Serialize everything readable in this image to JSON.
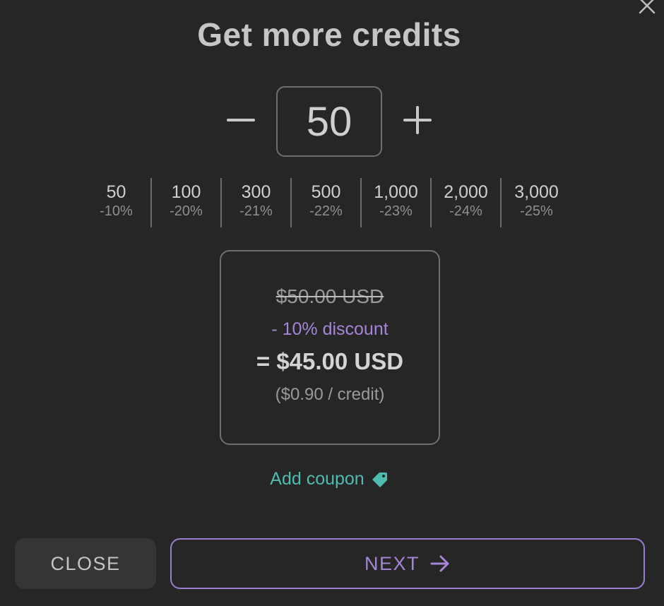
{
  "dialog": {
    "title": "Get more credits"
  },
  "stepper": {
    "quantity": "50"
  },
  "presets": [
    {
      "amount": "50",
      "discount": "-10%"
    },
    {
      "amount": "100",
      "discount": "-20%"
    },
    {
      "amount": "300",
      "discount": "-21%"
    },
    {
      "amount": "500",
      "discount": "-22%"
    },
    {
      "amount": "1,000",
      "discount": "-23%"
    },
    {
      "amount": "2,000",
      "discount": "-24%"
    },
    {
      "amount": "3,000",
      "discount": "-25%"
    }
  ],
  "price": {
    "original": "$50.00 USD",
    "discount": "- 10% discount",
    "total": "= $45.00 USD",
    "per_credit": "($0.90 / credit)"
  },
  "coupon": {
    "label": "Add coupon"
  },
  "buttons": {
    "close_label": "CLOSE",
    "next_label": "NEXT"
  },
  "icons": {
    "close": "close-icon",
    "minus": "minus-icon",
    "plus": "plus-icon",
    "tag": "tag-icon",
    "arrow": "arrow-right-icon"
  },
  "colors": {
    "background": "#262626",
    "accent_purple": "#a585d6",
    "accent_teal": "#4fbcb0",
    "text": "#c9c9c9",
    "border": "#6e6e6e"
  }
}
